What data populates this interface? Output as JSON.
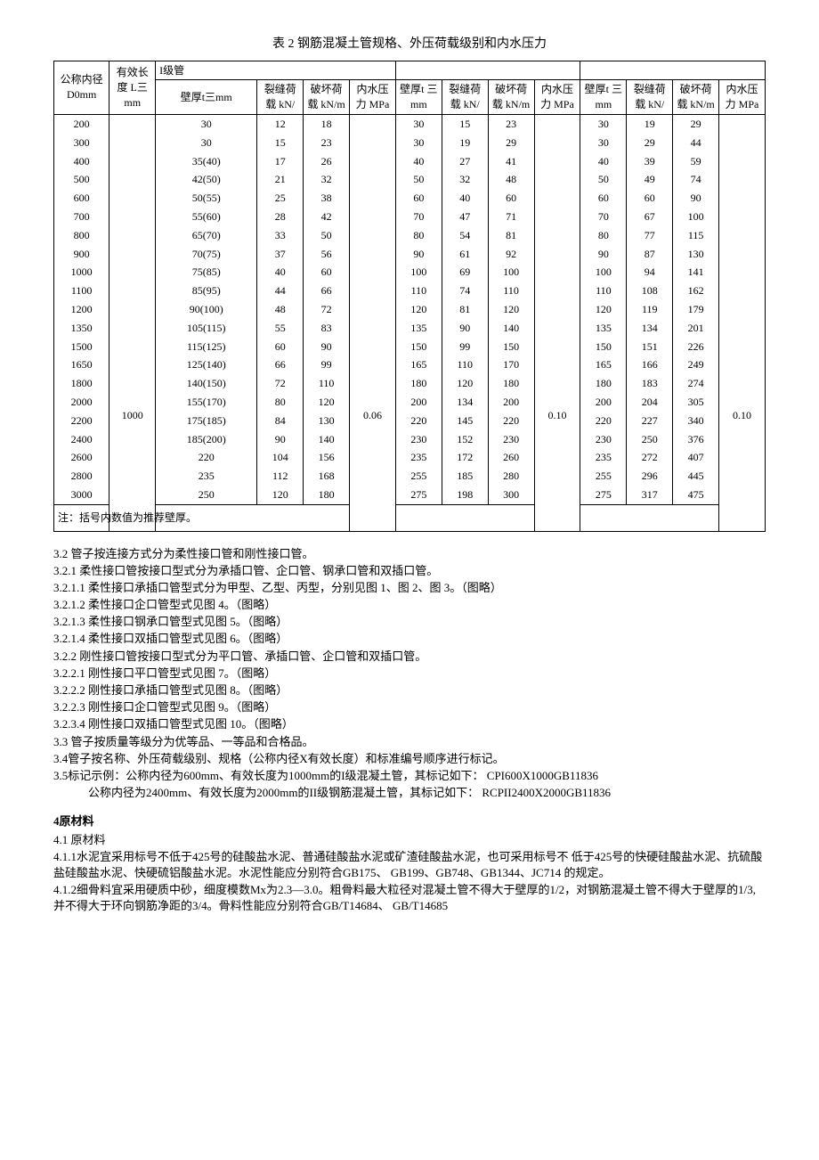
{
  "table_title": "表 2 钢筋混凝土管规格、外压荷载级别和内水压力",
  "headers": {
    "d0": "公称内径 D0mm",
    "l": "有效长度 L三mm",
    "grade1": "I级管",
    "t": "壁厚t三mm",
    "crack": "裂缝荷载 kN/",
    "break": "破坏荷载 kN/m",
    "pressure": "内水压力 MPa",
    "t_short": "壁厚t 三 mm"
  },
  "shared": {
    "l_value": "1000",
    "p1": "0.06",
    "p2": "0.10",
    "p3": "0.10"
  },
  "rows": [
    {
      "d0": "200",
      "t1": "30",
      "c1": "12",
      "b1": "18",
      "t2": "30",
      "c2": "15",
      "b2": "23",
      "t3": "30",
      "c3": "19",
      "b3": "29"
    },
    {
      "d0": "300",
      "t1": "30",
      "c1": "15",
      "b1": "23",
      "t2": "30",
      "c2": "19",
      "b2": "29",
      "t3": "30",
      "c3": "29",
      "b3": "44"
    },
    {
      "d0": "400",
      "t1": "35(40)",
      "c1": "17",
      "b1": "26",
      "t2": "40",
      "c2": "27",
      "b2": "41",
      "t3": "40",
      "c3": "39",
      "b3": "59"
    },
    {
      "d0": "500",
      "t1": "42(50)",
      "c1": "21",
      "b1": "32",
      "t2": "50",
      "c2": "32",
      "b2": "48",
      "t3": "50",
      "c3": "49",
      "b3": "74"
    },
    {
      "d0": "600",
      "t1": "50(55)",
      "c1": "25",
      "b1": "38",
      "t2": "60",
      "c2": "40",
      "b2": "60",
      "t3": "60",
      "c3": "60",
      "b3": "90"
    },
    {
      "d0": "700",
      "t1": "55(60)",
      "c1": "28",
      "b1": "42",
      "t2": "70",
      "c2": "47",
      "b2": "71",
      "t3": "70",
      "c3": "67",
      "b3": "100"
    },
    {
      "d0": "800",
      "t1": "65(70)",
      "c1": "33",
      "b1": "50",
      "t2": "80",
      "c2": "54",
      "b2": "81",
      "t3": "80",
      "c3": "77",
      "b3": "115"
    },
    {
      "d0": "900",
      "t1": "70(75)",
      "c1": "37",
      "b1": "56",
      "t2": "90",
      "c2": "61",
      "b2": "92",
      "t3": "90",
      "c3": "87",
      "b3": "130"
    },
    {
      "d0": "1000",
      "t1": "75(85)",
      "c1": "40",
      "b1": "60",
      "t2": "100",
      "c2": "69",
      "b2": "100",
      "t3": "100",
      "c3": "94",
      "b3": "141"
    },
    {
      "d0": "1100",
      "t1": "85(95)",
      "c1": "44",
      "b1": "66",
      "t2": "110",
      "c2": "74",
      "b2": "110",
      "t3": "110",
      "c3": "108",
      "b3": "162"
    },
    {
      "d0": "1200",
      "t1": "90(100)",
      "c1": "48",
      "b1": "72",
      "t2": "120",
      "c2": "81",
      "b2": "120",
      "t3": "120",
      "c3": "119",
      "b3": "179"
    },
    {
      "d0": "1350",
      "t1": "105(115)",
      "c1": "55",
      "b1": "83",
      "t2": "135",
      "c2": "90",
      "b2": "140",
      "t3": "135",
      "c3": "134",
      "b3": "201"
    },
    {
      "d0": "1500",
      "t1": "115(125)",
      "c1": "60",
      "b1": "90",
      "t2": "150",
      "c2": "99",
      "b2": "150",
      "t3": "150",
      "c3": "151",
      "b3": "226"
    },
    {
      "d0": "1650",
      "t1": "125(140)",
      "c1": "66",
      "b1": "99",
      "t2": "165",
      "c2": "110",
      "b2": "170",
      "t3": "165",
      "c3": "166",
      "b3": "249"
    },
    {
      "d0": "1800",
      "t1": "140(150)",
      "c1": "72",
      "b1": "110",
      "t2": "180",
      "c2": "120",
      "b2": "180",
      "t3": "180",
      "c3": "183",
      "b3": "274"
    },
    {
      "d0": "2000",
      "t1": "155(170)",
      "c1": "80",
      "b1": "120",
      "t2": "200",
      "c2": "134",
      "b2": "200",
      "t3": "200",
      "c3": "204",
      "b3": "305"
    },
    {
      "d0": "2200",
      "t1": "175(185)",
      "c1": "84",
      "b1": "130",
      "t2": "220",
      "c2": "145",
      "b2": "220",
      "t3": "220",
      "c3": "227",
      "b3": "340"
    },
    {
      "d0": "2400",
      "t1": "185(200)",
      "c1": "90",
      "b1": "140",
      "t2": "230",
      "c2": "152",
      "b2": "230",
      "t3": "230",
      "c3": "250",
      "b3": "376"
    },
    {
      "d0": "2600",
      "t1": "220",
      "c1": "104",
      "b1": "156",
      "t2": "235",
      "c2": "172",
      "b2": "260",
      "t3": "235",
      "c3": "272",
      "b3": "407"
    },
    {
      "d0": "2800",
      "t1": "235",
      "c1": "112",
      "b1": "168",
      "t2": "255",
      "c2": "185",
      "b2": "280",
      "t3": "255",
      "c3": "296",
      "b3": "445"
    },
    {
      "d0": "3000",
      "t1": "250",
      "c1": "120",
      "b1": "180",
      "t2": "275",
      "c2": "198",
      "b2": "300",
      "t3": "275",
      "c3": "317",
      "b3": "475"
    }
  ],
  "table_note": "注：括号内数值为推荐壁厚。",
  "paragraphs": [
    "3.2  管子按连接方式分为柔性接口管和刚性接口管。",
    "3.2.1  柔性接口管按接口型式分为承插口管、企口管、钢承口管和双插口管。",
    "3.2.1.1  柔性接口承插口管型式分为甲型、乙型、丙型，分别见图 1、图 2、图 3。（图略）",
    "3.2.1.2  柔性接口企口管型式见图 4。（图略）",
    "3.2.1.3  柔性接口钢承口管型式见图 5。（图略）",
    "3.2.1.4  柔性接口双插口管型式见图 6。（图略）",
    "3.2.2 刚性接口管按接口型式分为平口管、承插口管、企口管和双插口管。",
    "3.2.2.1  刚性接口平口管型式见图 7。（图略）",
    "3.2.2.2  刚性接口承插口管型式见图 8。（图略）",
    "3.2.2.3  刚性接口企口管型式见图 9。（图略）",
    "3.2.3.4  刚性接口双插口管型式见图 10。（图略）",
    "3.3  管子按质量等级分为优等品、一等品和合格品。",
    "3.4管子按名称、外压荷载级别、规格（公称内径X有效长度）和标准编号顺序进行标记。",
    "3.5标记示例：公称内径为600mm、有效长度为1000mm的I级混凝土管，其标记如下： CPI600X1000GB11836"
  ],
  "indent_line": "公称内径为2400mm、有效长度为2000mm的II级钢筋混凝土管，其标记如下： RCPII2400X2000GB11836",
  "section4_title": "4原材料",
  "section4_paragraphs": [
    "4.1 原材料",
    "4.1.1水泥宜采用标号不低于425号的硅酸盐水泥、普通硅酸盐水泥或矿渣硅酸盐水泥，也可采用标号不 低于425号的快硬硅酸盐水泥、抗硫酸盐硅酸盐水泥、快硬硫铝酸盐水泥。水泥性能应分别符合GB175、 GB199、GB748、GB1344、JC714 的规定。",
    "4.1.2细骨料宜采用硬质中砂，细度模数Mx为2.3—3.0。粗骨料最大粒径对混凝土管不得大于壁厚的1/2，对钢筋混凝土管不得大于壁厚的1/3,并不得大于环向钢筋净距的3/4。骨料性能应分别符合GB/T14684、 GB/T14685"
  ]
}
